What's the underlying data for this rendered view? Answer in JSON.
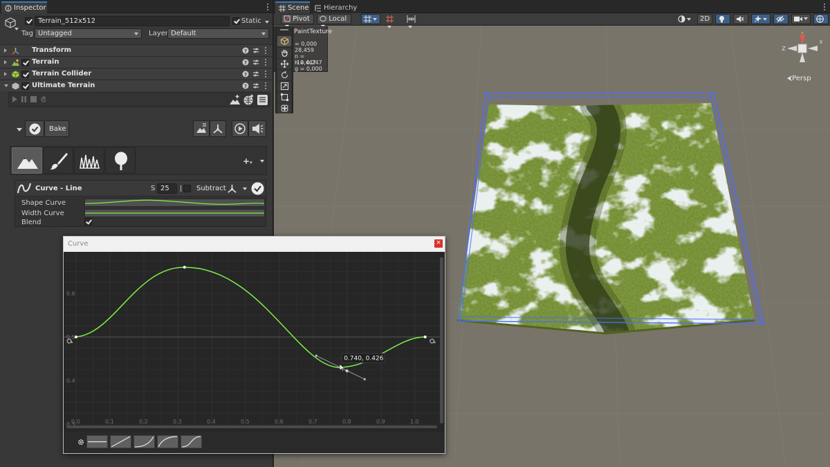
{
  "inspector": {
    "tab_label": "Inspector",
    "object": {
      "name": "Terrain_512x512",
      "static_label": "Static",
      "tag_label": "Tag",
      "tag_value": "Untagged",
      "layer_label": "Layer",
      "layer_value": "Default"
    },
    "components": [
      {
        "name": "Transform",
        "icon": "transform-icon"
      },
      {
        "name": "Terrain",
        "icon": "terrain-icon"
      },
      {
        "name": "Terrain Collider",
        "icon": "terrain-collider-icon"
      },
      {
        "name": "Ultimate Terrain",
        "icon": "ultimate-terrain-icon"
      }
    ],
    "toolbar": {
      "bake_label": "Bake"
    },
    "brush_tabs": [
      "mountain-icon",
      "paint-brush-icon",
      "grass-icon",
      "tree-icon"
    ],
    "operation": {
      "name": "Curve - Line",
      "size_label": "S",
      "size_value": "25",
      "mode_label": "Subtract",
      "fields": [
        {
          "label": "Shape Curve"
        },
        {
          "label": "Width Curve"
        },
        {
          "label": "Blend"
        }
      ]
    }
  },
  "scene": {
    "tabs": [
      "Scene",
      "Hierarchy"
    ],
    "pivot_label": "Pivot",
    "local_label": "Local",
    "mode_2d_label": "2D",
    "persp_label": "Persp",
    "overlay": {
      "title": "PaintTexture",
      "lines": [
        "= 0,000",
        "28,459",
        "n = -18,447",
        "h = 0,247",
        "g = 0,000"
      ]
    },
    "gizmo_axes": {
      "x": "X",
      "z": "Z",
      "y": "Y"
    },
    "colors": {
      "terrain_green": "#6f8a2e",
      "selection_blue": "#4a6cff",
      "ground": "#79746a"
    }
  },
  "curve_window": {
    "title": "Curve",
    "close_label": "×",
    "tooltip": "0.740, 0.426",
    "y_tick_labels": [
      "0.6",
      "0.5",
      "0.4",
      "0.3"
    ],
    "x_tick_labels": [
      "0.0",
      "0.1",
      "0.2",
      "0.3",
      "0.4",
      "0.5",
      "0.6",
      "0.7",
      "0.8",
      "0.9",
      "1.0"
    ],
    "curve_color": "#7cf04a",
    "keys": [
      {
        "t": 0.0,
        "v": 0.5
      },
      {
        "t": 0.32,
        "v": 0.66
      },
      {
        "t": 0.78,
        "v": 0.43
      },
      {
        "t": 1.03,
        "v": 0.5
      }
    ],
    "presets": [
      "flat-preset-icon",
      "linear-preset-icon",
      "ease-in-preset-icon",
      "ease-out-preset-icon",
      "ease-in-out-preset-icon"
    ]
  }
}
